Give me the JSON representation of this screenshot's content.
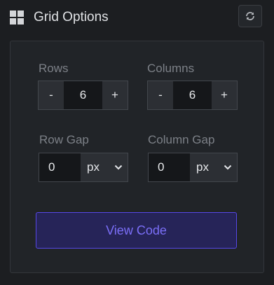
{
  "header": {
    "title": "Grid Options",
    "icon": "grid-icon",
    "refresh_icon": "refresh-icon"
  },
  "rows": {
    "label": "Rows",
    "decrement": "-",
    "value": "6",
    "increment": "+"
  },
  "columns": {
    "label": "Columns",
    "decrement": "-",
    "value": "6",
    "increment": "+"
  },
  "row_gap": {
    "label": "Row Gap",
    "value": "0",
    "unit": "px"
  },
  "column_gap": {
    "label": "Column Gap",
    "value": "0",
    "unit": "px"
  },
  "actions": {
    "view_code": "View Code"
  },
  "colors": {
    "background": "#1c1e21",
    "card": "#212428",
    "accent": "#5648e6",
    "accent_text": "#7b6ff8"
  }
}
